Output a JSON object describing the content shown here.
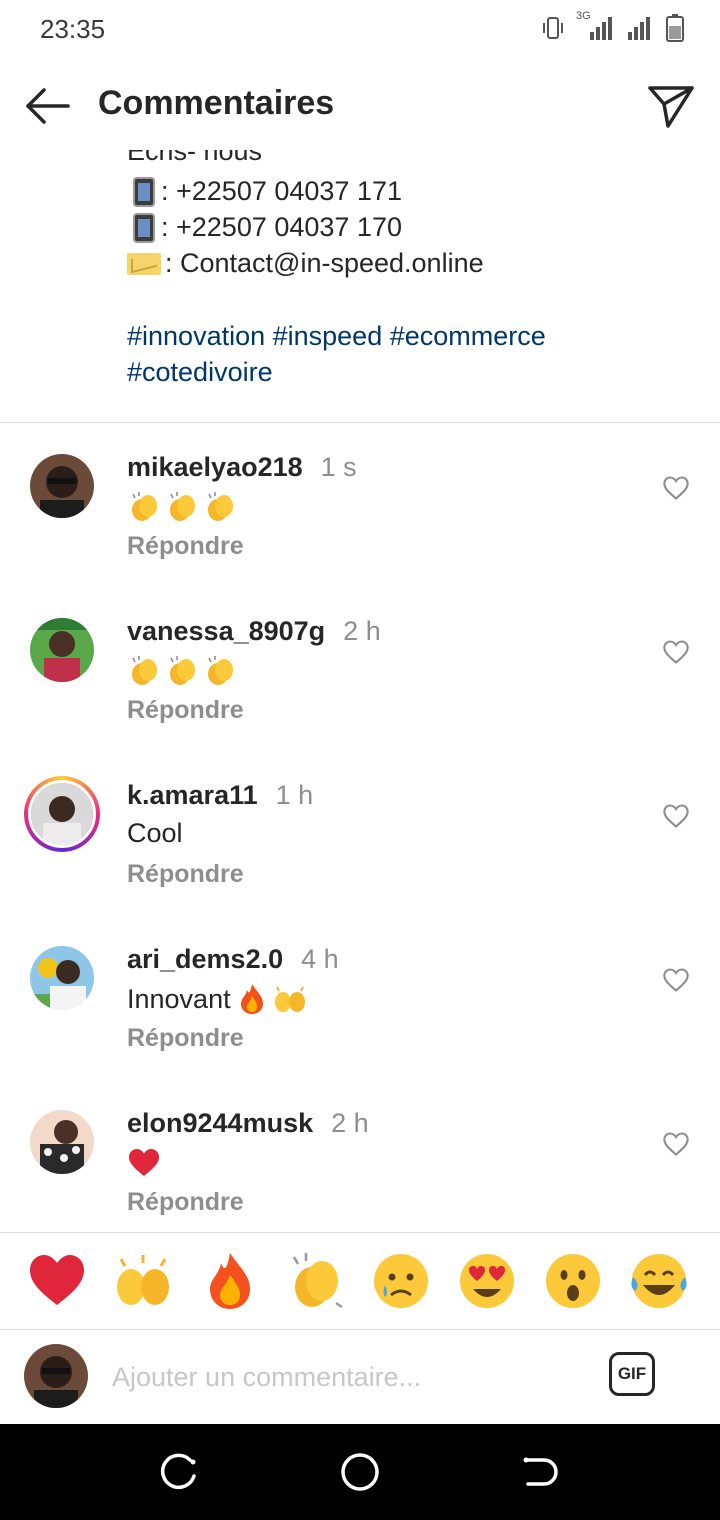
{
  "status_bar": {
    "time": "23:35",
    "network": "3G"
  },
  "header": {
    "title": "Commentaires"
  },
  "caption": {
    "clipped_line": "Ecris- nous",
    "contacts": [
      {
        "icon": "mobile-phone-icon",
        "text": ": +22507 04037 171"
      },
      {
        "icon": "mobile-phone-icon",
        "text": ": +22507 04037 170"
      },
      {
        "icon": "envelope-icon",
        "text": ": Contact@in-speed.online"
      }
    ],
    "hashtags": "#innovation #inspeed #ecommerce #cotedivoire"
  },
  "comments": [
    {
      "username": "mikaelyao218",
      "time": "1 s",
      "text": "",
      "emojis": [
        "clapping-hands",
        "clapping-hands",
        "clapping-hands"
      ],
      "reply": "Répondre"
    },
    {
      "username": "vanessa_8907g",
      "time": "2 h",
      "text": "",
      "emojis": [
        "clapping-hands",
        "clapping-hands",
        "clapping-hands"
      ],
      "reply": "Répondre"
    },
    {
      "username": "k.amara11",
      "time": "1 h",
      "text": "Cool",
      "emojis": [],
      "reply": "Répondre"
    },
    {
      "username": "ari_dems2.0",
      "time": "4 h",
      "text": "Innovant",
      "emojis": [
        "fire",
        "raising-hands"
      ],
      "reply": "Répondre"
    },
    {
      "username": "elon9244musk",
      "time": "2 h",
      "text": "",
      "emojis": [
        "red-heart"
      ],
      "reply": "Répondre"
    }
  ],
  "reactions": [
    "red-heart",
    "raising-hands",
    "fire",
    "clapping-hands",
    "sad-tear-face",
    "heart-eyes-face",
    "surprised-face",
    "tears-of-joy-face"
  ],
  "composer": {
    "placeholder": "Ajouter un commentaire...",
    "gif_label": "GIF"
  },
  "colors": {
    "hashtag": "#00376b",
    "muted": "#8e8e8e",
    "divider": "#dbdbdb"
  }
}
